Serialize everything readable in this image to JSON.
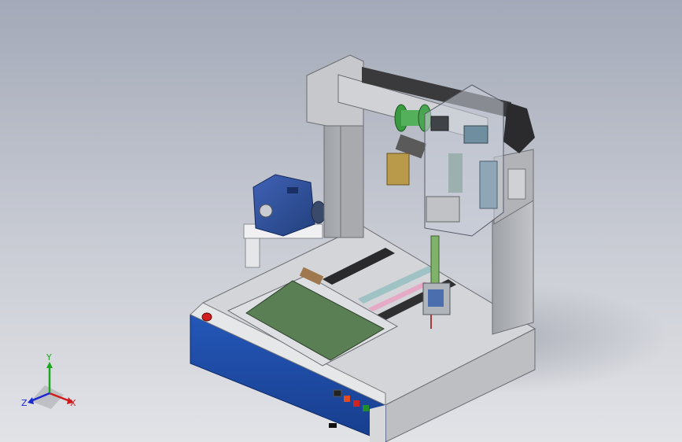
{
  "scene": {
    "background_top": "#a3a9b8",
    "background_bottom": "#e2e3e7",
    "base_blue": "#1e4aa8",
    "pcb_green": "#5a7f55",
    "frame_grey": "#b9bbbe",
    "motor_blue": "#2c4f9a"
  },
  "triad": {
    "x_label": "X",
    "y_label": "Y",
    "z_label": "Z",
    "x_color": "#d01c1c",
    "y_color": "#19a81e",
    "z_color": "#1b28d0"
  }
}
